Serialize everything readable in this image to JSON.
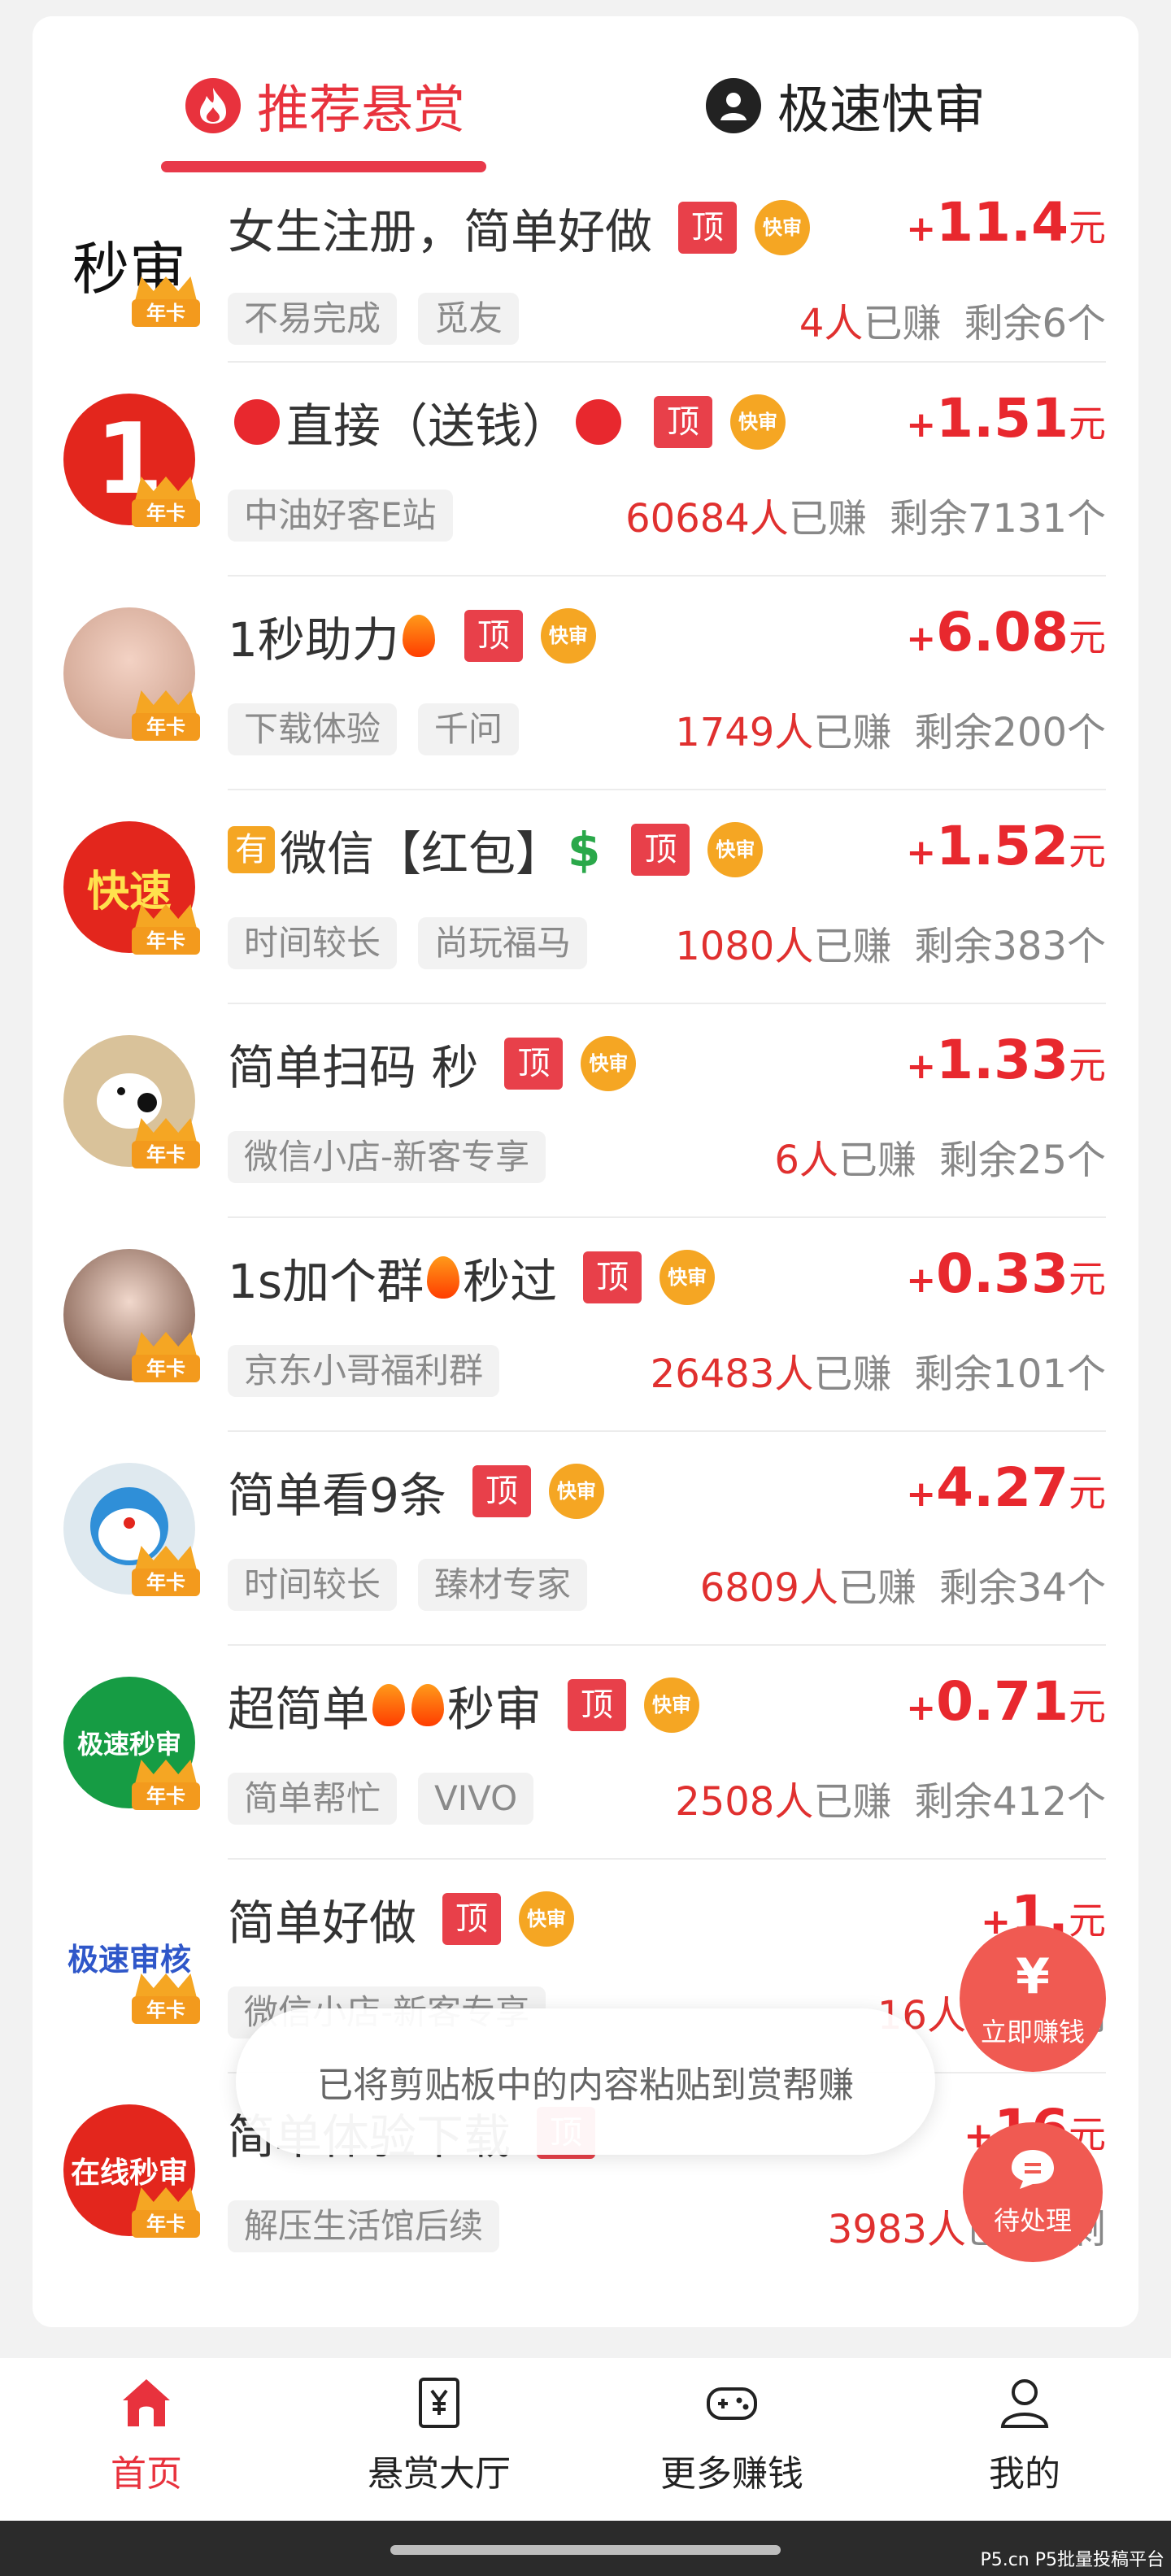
{
  "tabs": [
    {
      "label": "推荐悬赏",
      "icon": "fire-icon",
      "active": true
    },
    {
      "label": "极速快审",
      "icon": "user-circle-icon",
      "active": false
    }
  ],
  "badges": {
    "top": "顶",
    "fast": "快审",
    "annual": "年卡"
  },
  "colors": {
    "accent": "#e8323d",
    "price": "#e8282e",
    "tag_bg": "#f2f2f2",
    "badge_fast": "#f5a623"
  },
  "tasks": [
    {
      "title": "女生注册，简单好做",
      "tags": [
        "不易完成",
        "觅友"
      ],
      "price_sign": "+",
      "price": "11.4",
      "unit": "元",
      "earned_count": "4人",
      "earned_label": "已赚",
      "remaining": "剩余6个",
      "avatar_text": "秒审"
    },
    {
      "title_pre": "",
      "title": "直接（送钱）",
      "tags": [
        "中油好客E站"
      ],
      "price_sign": "+",
      "price": "1.51",
      "unit": "元",
      "earned_count": "60684人",
      "earned_label": "已赚",
      "remaining": "剩余7131个",
      "avatar_text": "1"
    },
    {
      "title": "1秒助力",
      "tags": [
        "下载体验",
        "千问"
      ],
      "price_sign": "+",
      "price": "6.08",
      "unit": "元",
      "earned_count": "1749人",
      "earned_label": "已赚",
      "remaining": "剩余200个",
      "avatar_text": ""
    },
    {
      "title_badge": "有",
      "title": "微信【红包】",
      "title_post": "$",
      "tags": [
        "时间较长",
        "尚玩福马"
      ],
      "price_sign": "+",
      "price": "1.52",
      "unit": "元",
      "earned_count": "1080人",
      "earned_label": "已赚",
      "remaining": "剩余383个",
      "avatar_text": "快速"
    },
    {
      "title": "简单扫码 秒",
      "tags": [
        "微信小店-新客专享"
      ],
      "price_sign": "+",
      "price": "1.33",
      "unit": "元",
      "earned_count": "6人",
      "earned_label": "已赚",
      "remaining": "剩余25个",
      "avatar_text": ""
    },
    {
      "title": "1s加个群",
      "title_post": "秒过",
      "tags": [
        "京东小哥福利群"
      ],
      "price_sign": "+",
      "price": "0.33",
      "unit": "元",
      "earned_count": "26483人",
      "earned_label": "已赚",
      "remaining": "剩余101个",
      "avatar_text": ""
    },
    {
      "title": "简单看9条",
      "tags": [
        "时间较长",
        "臻材专家"
      ],
      "price_sign": "+",
      "price": "4.27",
      "unit": "元",
      "earned_count": "6809人",
      "earned_label": "已赚",
      "remaining": "剩余34个",
      "avatar_text": ""
    },
    {
      "title": "超简单",
      "title_post": "秒审",
      "tags": [
        "简单帮忙",
        "VIVO"
      ],
      "price_sign": "+",
      "price": "0.71",
      "unit": "元",
      "earned_count": "2508人",
      "earned_label": "已赚",
      "remaining": "剩余412个",
      "avatar_text": "极速秒审"
    },
    {
      "title": "简单好做",
      "tags": [
        "微信小店-新客专享"
      ],
      "price_sign": "+",
      "price": "1.",
      "unit": "元",
      "earned_count": "16人",
      "earned_label": "已赚",
      "remaining": "剩",
      "avatar_text": "极速审核"
    },
    {
      "title": "简单体验下载",
      "tags": [
        "解压生活馆后续"
      ],
      "price_sign": "+",
      "price": "16",
      "unit": "元",
      "earned_count": "3983人",
      "earned_label": "已赚",
      "remaining": "剩",
      "avatar_text": "在线秒审"
    }
  ],
  "toast": "已将剪贴板中的内容粘贴到赏帮赚",
  "fab_earn": "立即赚钱",
  "fab_pending": "待处理",
  "fab_earn_symbol": "¥",
  "bottom_nav": [
    {
      "label": "首页",
      "icon": "home-icon",
      "active": true
    },
    {
      "label": "悬赏大厅",
      "icon": "yen-scroll-icon",
      "active": false
    },
    {
      "label": "更多赚钱",
      "icon": "gamepad-icon",
      "active": false
    },
    {
      "label": "我的",
      "icon": "user-icon",
      "active": false
    }
  ],
  "watermark": "P5.cn P5批量投稿平台"
}
